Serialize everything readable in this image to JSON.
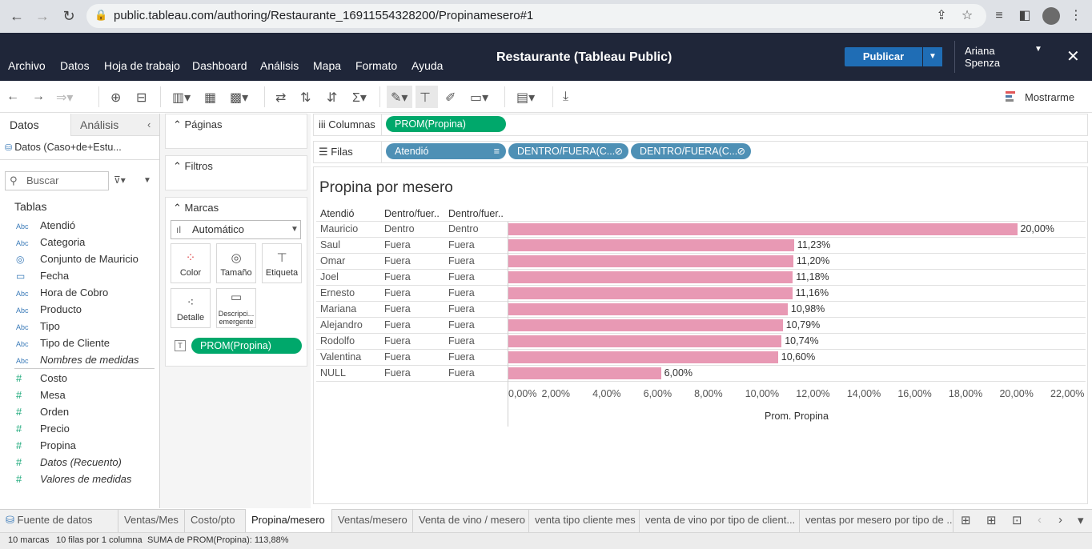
{
  "browser": {
    "url": "public.tableau.com/authoring/Restaurante_16911554328200/Propinamesero#1"
  },
  "app": {
    "menu": [
      "Archivo",
      "Datos",
      "Hoja de trabajo",
      "Dashboard",
      "Análisis",
      "Mapa",
      "Formato",
      "Ayuda"
    ],
    "title": "Restaurante (Tableau Public)",
    "publish_label": "Publicar",
    "user_line1": "Ariana",
    "user_line2": "Spenza",
    "mostrarme": "Mostrarme"
  },
  "datapane": {
    "tab_datos": "Datos",
    "tab_analisis": "Análisis",
    "datasource": "Datos (Caso+de+Estu...",
    "search_placeholder": "Buscar",
    "tables_heading": "Tablas",
    "dimensions": [
      {
        "type": "Abc",
        "name": "Atendió"
      },
      {
        "type": "Abc",
        "name": "Categoria"
      },
      {
        "type": "set",
        "name": "Conjunto de Mauricio"
      },
      {
        "type": "date",
        "name": "Fecha"
      },
      {
        "type": "Abc",
        "name": "Hora de Cobro"
      },
      {
        "type": "Abc",
        "name": "Producto"
      },
      {
        "type": "Abc",
        "name": "Tipo"
      },
      {
        "type": "Abc",
        "name": "Tipo de Cliente"
      },
      {
        "type": "Abc",
        "name": "Nombres de medidas",
        "italic": true
      }
    ],
    "measures": [
      {
        "name": "Costo"
      },
      {
        "name": "Mesa"
      },
      {
        "name": "Orden"
      },
      {
        "name": "Precio"
      },
      {
        "name": "Propina"
      },
      {
        "name": "Datos (Recuento)",
        "italic": true
      },
      {
        "name": "Valores de medidas",
        "italic": true
      }
    ]
  },
  "cards": {
    "pages": "Páginas",
    "filters": "Filtros",
    "marks": "Marcas",
    "mark_type": "Automático",
    "mark_buttons": [
      "Color",
      "Tamaño",
      "Etiqueta",
      "Detalle",
      "Descripci... emergente"
    ],
    "mark_pill": "PROM(Propina)"
  },
  "shelves": {
    "columns_label": "Columnas",
    "columns_pill": "PROM(Propina)",
    "rows_label": "Filas",
    "rows_pills": [
      "Atendió",
      "DENTRO/FUERA(C...",
      "DENTRO/FUERA(C..."
    ]
  },
  "view": {
    "title": "Propina por mesero",
    "headers": [
      "Atendió",
      "Dentro/fuer..",
      "Dentro/fuer.."
    ],
    "axis_title": "Prom. Propina",
    "ticks": [
      "0,00%",
      "2,00%",
      "4,00%",
      "6,00%",
      "8,00%",
      "10,00%",
      "12,00%",
      "14,00%",
      "16,00%",
      "18,00%",
      "20,00%",
      "22,00%"
    ]
  },
  "chart_data": {
    "type": "bar",
    "orientation": "horizontal",
    "title": "Propina por mesero",
    "xlabel": "Prom. Propina",
    "xlim": [
      0,
      22
    ],
    "rows": [
      {
        "atendio": "Mauricio",
        "d1": "Dentro",
        "d2": "Dentro",
        "value": 20.0,
        "label": "20,00%"
      },
      {
        "atendio": "Saul",
        "d1": "Fuera",
        "d2": "Fuera",
        "value": 11.23,
        "label": "11,23%"
      },
      {
        "atendio": "Omar",
        "d1": "Fuera",
        "d2": "Fuera",
        "value": 11.2,
        "label": "11,20%"
      },
      {
        "atendio": "Joel",
        "d1": "Fuera",
        "d2": "Fuera",
        "value": 11.18,
        "label": "11,18%"
      },
      {
        "atendio": "Ernesto",
        "d1": "Fuera",
        "d2": "Fuera",
        "value": 11.16,
        "label": "11,16%"
      },
      {
        "atendio": "Mariana",
        "d1": "Fuera",
        "d2": "Fuera",
        "value": 10.98,
        "label": "10,98%"
      },
      {
        "atendio": "Alejandro",
        "d1": "Fuera",
        "d2": "Fuera",
        "value": 10.79,
        "label": "10,79%"
      },
      {
        "atendio": "Rodolfo",
        "d1": "Fuera",
        "d2": "Fuera",
        "value": 10.74,
        "label": "10,74%"
      },
      {
        "atendio": "Valentina",
        "d1": "Fuera",
        "d2": "Fuera",
        "value": 10.6,
        "label": "10,60%"
      },
      {
        "atendio": "NULL",
        "d1": "Fuera",
        "d2": "Fuera",
        "value": 6.0,
        "label": "6,00%"
      }
    ],
    "bar_color": "#e899b4"
  },
  "sheets": {
    "datasource_tab": "Fuente de datos",
    "tabs": [
      "Ventas/Mes",
      "Costo/pto",
      "Propina/mesero",
      "Ventas/mesero",
      "Venta de vino / mesero",
      "venta tipo cliente mes",
      "venta de vino por tipo de client...",
      "ventas por mesero por tipo de ..."
    ],
    "active": "Propina/mesero"
  },
  "status": {
    "marks": "10 marcas",
    "rows": "10 filas por 1 columna",
    "sum": "SUMA de PROM(Propina): 113,88%"
  },
  "colors": {
    "header_bg": "#1f2639",
    "publish": "#1f6db5",
    "measure_pill": "#00a86b",
    "dimension_pill": "#4e90b5"
  }
}
